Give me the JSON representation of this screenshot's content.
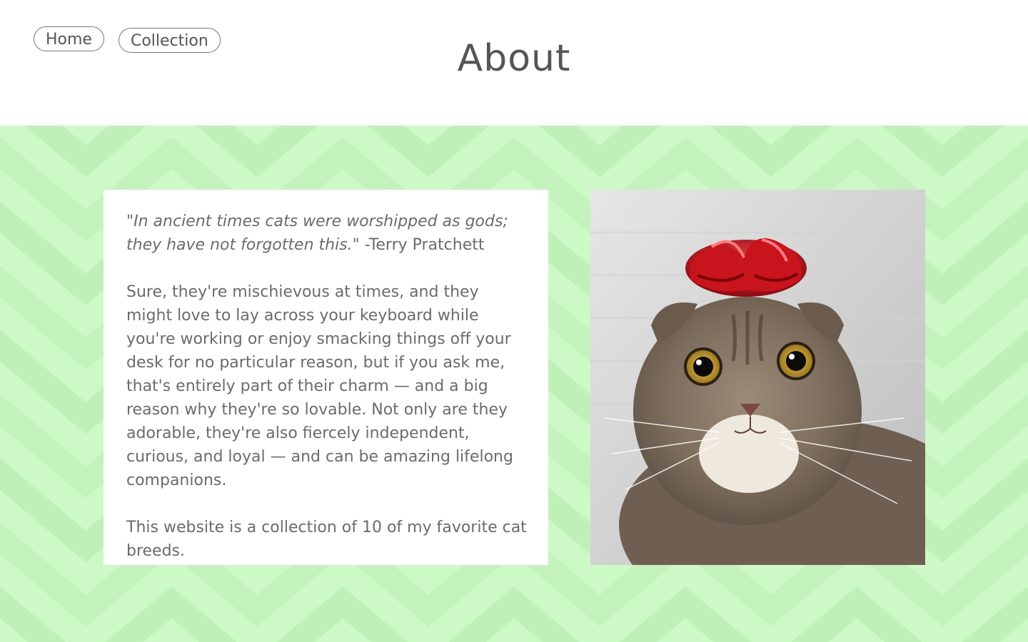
{
  "nav": {
    "home_label": "Home",
    "collection_label": "Collection"
  },
  "header": {
    "title": "About"
  },
  "content": {
    "quote_text": "\"In ancient times cats were worshipped as gods; they have not forgotten this.\"",
    "quote_author": " -Terry Pratchett",
    "paragraph_1": "Sure, they're mischievous at times, and they might love to lay across your keyboard while you're working or enjoy smacking things off your desk for no particular reason, but if you ask me, that's entirely part of their charm — and a big reason why they're so lovable. Not only are they adorable, they're also fiercely independent, curious, and loyal — and can be amazing lifelong companions.",
    "paragraph_2": "This website is a collection of 10 of my favorite cat breeds."
  },
  "colors": {
    "background_green": "#ccf9c6",
    "chevron_green": "#bff0b8",
    "text_gray": "#6b6b6b",
    "bow_red": "#c8141c"
  }
}
